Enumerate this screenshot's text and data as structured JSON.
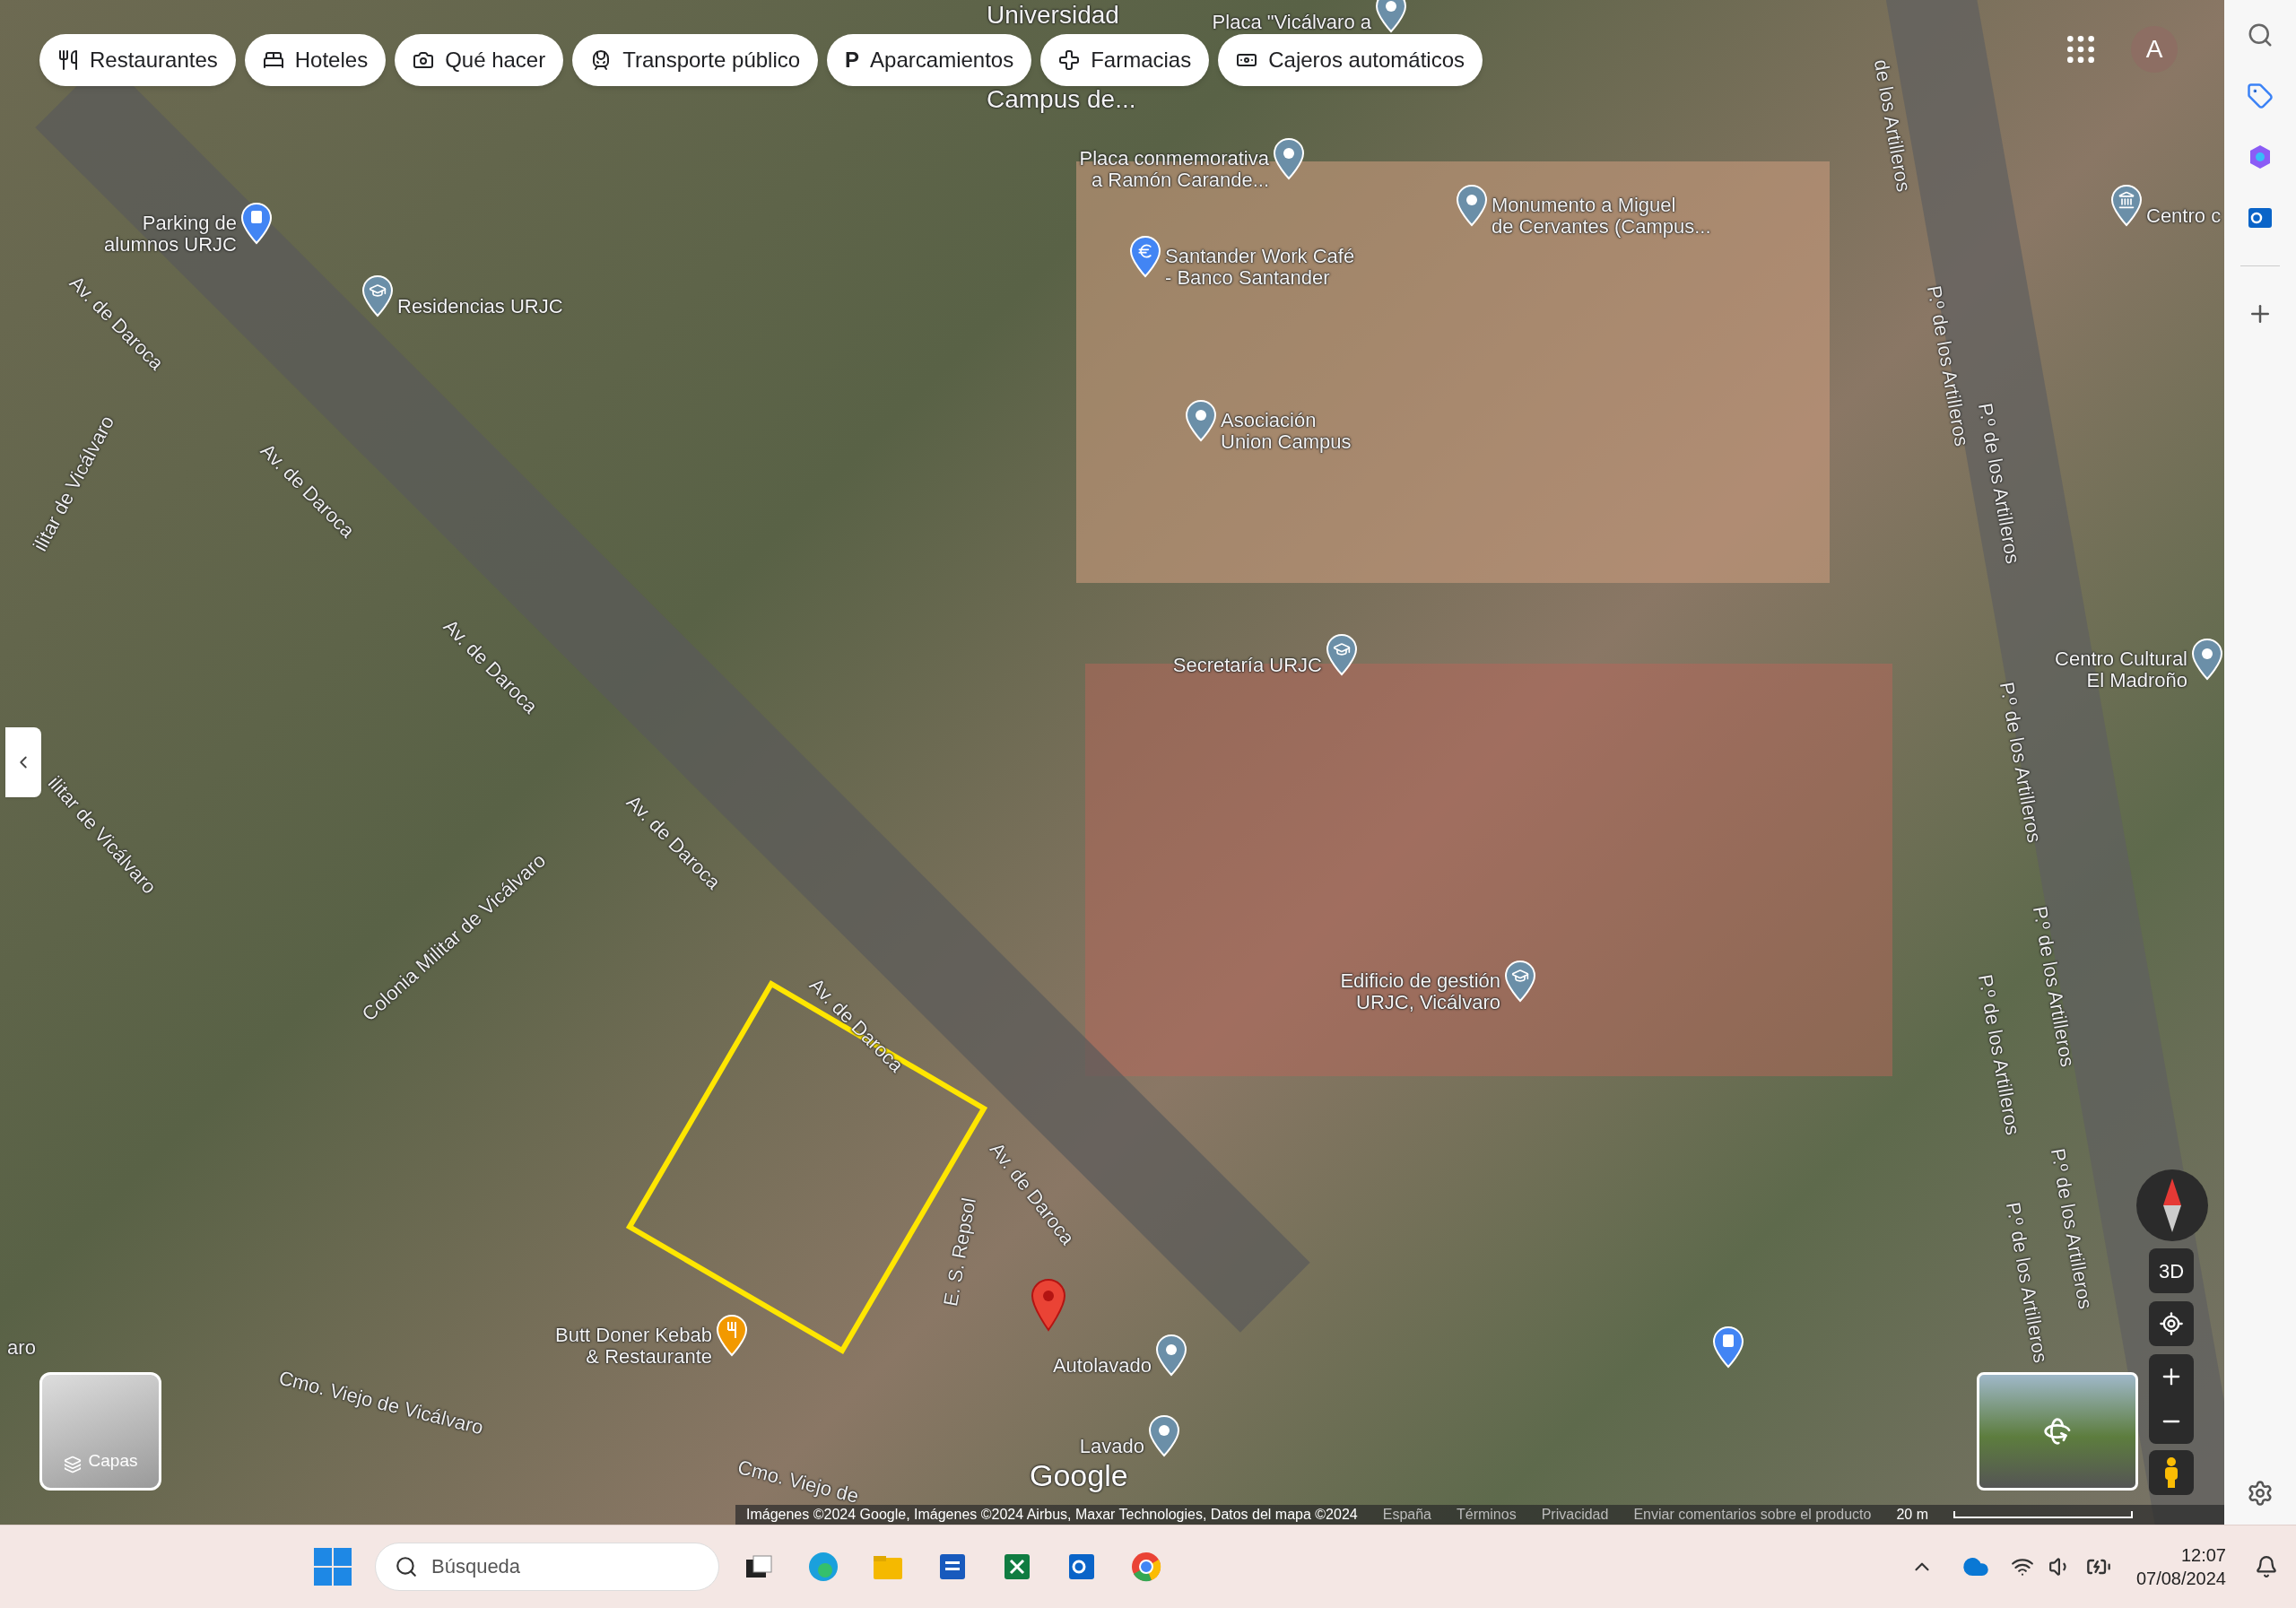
{
  "chips": [
    {
      "label": "Restaurantes"
    },
    {
      "label": "Hoteles"
    },
    {
      "label": "Qué hacer"
    },
    {
      "label": "Transporte público"
    },
    {
      "label": "Aparcamientos",
      "glyph": "P"
    },
    {
      "label": "Farmacias"
    },
    {
      "label": "Cajeros automáticos"
    }
  ],
  "map": {
    "avatar": "A",
    "place_labels": [
      {
        "kind": "area",
        "text": "Universidad"
      },
      {
        "kind": "area",
        "text": "Campus de..."
      },
      {
        "kind": "pin",
        "text": "Placa \"Vicálvaro a"
      },
      {
        "kind": "parking",
        "text": "Parking de\nalumnos URJC"
      },
      {
        "kind": "school",
        "text": "Residencias URJC"
      },
      {
        "kind": "pin",
        "text": "Placa conmemorativa\na Ramón Carande..."
      },
      {
        "kind": "pin",
        "text": "Monumento a Miguel\nde Cervantes (Campus..."
      },
      {
        "kind": "bank",
        "text": "Santander Work Café\n- Banco Santander"
      },
      {
        "kind": "pin",
        "text": "Asociación\nUnion Campus"
      },
      {
        "kind": "school",
        "text": "Secretaría URJC"
      },
      {
        "kind": "museum",
        "text": "Centro c"
      },
      {
        "kind": "pin",
        "text": "Centro Cultural\nEl Madroño"
      },
      {
        "kind": "school",
        "text": "Edificio de gestión\nURJC, Vicálvaro"
      },
      {
        "kind": "food",
        "text": "Butt Doner Kebab\n& Restaurante"
      },
      {
        "kind": "pin",
        "text": "Autolavado"
      },
      {
        "kind": "pin",
        "text": "Lavado"
      }
    ],
    "street_labels": [
      "Av. de Daroca",
      "Av. de Daroca",
      "Av. de Daroca",
      "Av. de Daroca",
      "Av. de Daroca",
      "Av. de Daroca",
      "ilitar de Vicálvaro",
      "ilitar de Vicálvaro",
      "Colonia Militar de Vicálvaro",
      "Cmo. Viejo de Vicálvaro",
      "Cmo. Viejo de",
      "E. S. Repsol",
      "aro",
      "de los Artilleros",
      "P.º de los Artilleros",
      "P.º de los Artilleros",
      "P.º de los Artilleros",
      "P.º de los Artilleros",
      "P.º de los Artilleros",
      "P.º de los Artilleros",
      "P.º de los Artilleros"
    ],
    "layers_button": "Capas",
    "view_3d": "3D",
    "google_logo": "Google",
    "attribution": "Imágenes ©2024 Google, Imágenes ©2024 Airbus, Maxar Technologies, Datos del mapa ©2024",
    "footer_links": [
      "España",
      "Términos",
      "Privacidad",
      "Enviar comentarios sobre el producto"
    ],
    "scale": "20 m"
  },
  "taskbar": {
    "search_placeholder": "Búsqueda",
    "time": "12:07",
    "date": "07/08/2024"
  }
}
